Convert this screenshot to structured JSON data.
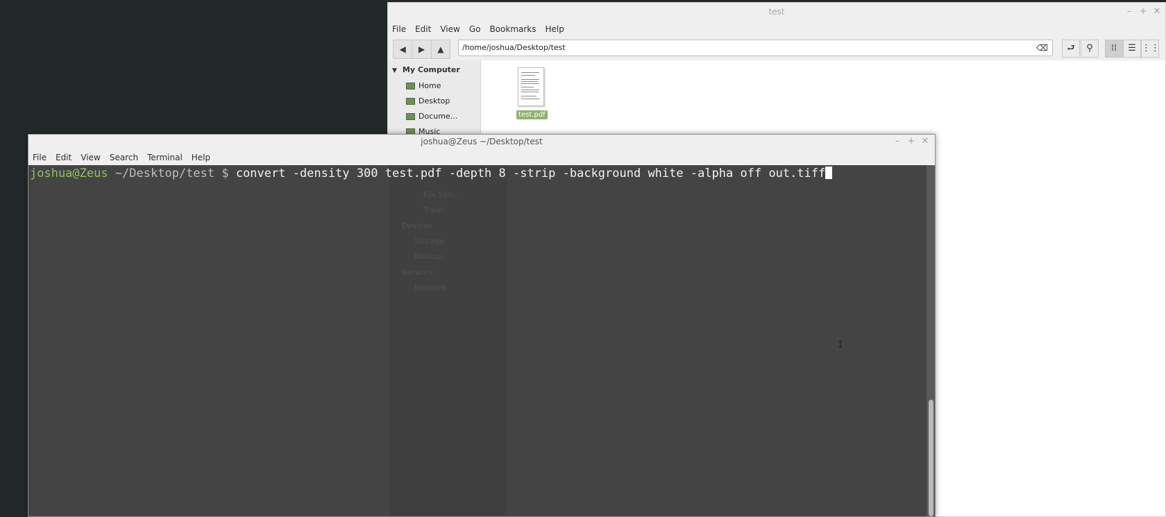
{
  "file_manager": {
    "title": "test",
    "menu": [
      "File",
      "Edit",
      "View",
      "Go",
      "Bookmarks",
      "Help"
    ],
    "location": "/home/joshua/Desktop/test",
    "sidebar": {
      "heading": "My Computer",
      "items": [
        "Home",
        "Desktop",
        "Docume...",
        "Music"
      ]
    },
    "sidebar_hidden": {
      "items": [
        "File Sys...",
        "Trash"
      ],
      "devices_heading": "Devices",
      "devices": [
        "Storage",
        "Backup"
      ],
      "network_heading": "Network",
      "network_items": [
        "Network"
      ]
    },
    "files": [
      {
        "name": "test.pdf",
        "icon": "pdf-thumbnail"
      }
    ]
  },
  "terminal": {
    "title": "joshua@Zeus ~/Desktop/test",
    "menu": [
      "File",
      "Edit",
      "View",
      "Search",
      "Terminal",
      "Help"
    ],
    "prompt_user": "joshua@Zeus",
    "prompt_path": " ~/Desktop/test $ ",
    "command": "convert -density 300 test.pdf -depth 8 -strip -background white -alpha off out.tiff"
  },
  "icons": {
    "back": "arrow-left-icon",
    "forward": "arrow-right-icon",
    "up": "arrow-up-icon",
    "clear": "backspace-icon",
    "toggle_location": "toggle-location-icon",
    "search": "search-icon",
    "icon_view": "grid-view-icon",
    "list_view": "list-view-icon",
    "compact_view": "compact-view-icon"
  },
  "colors": {
    "desktop": "#23292a",
    "terminal_bg": "#444444",
    "prompt_user": "#93c15a",
    "selection": "#8fb26a"
  }
}
